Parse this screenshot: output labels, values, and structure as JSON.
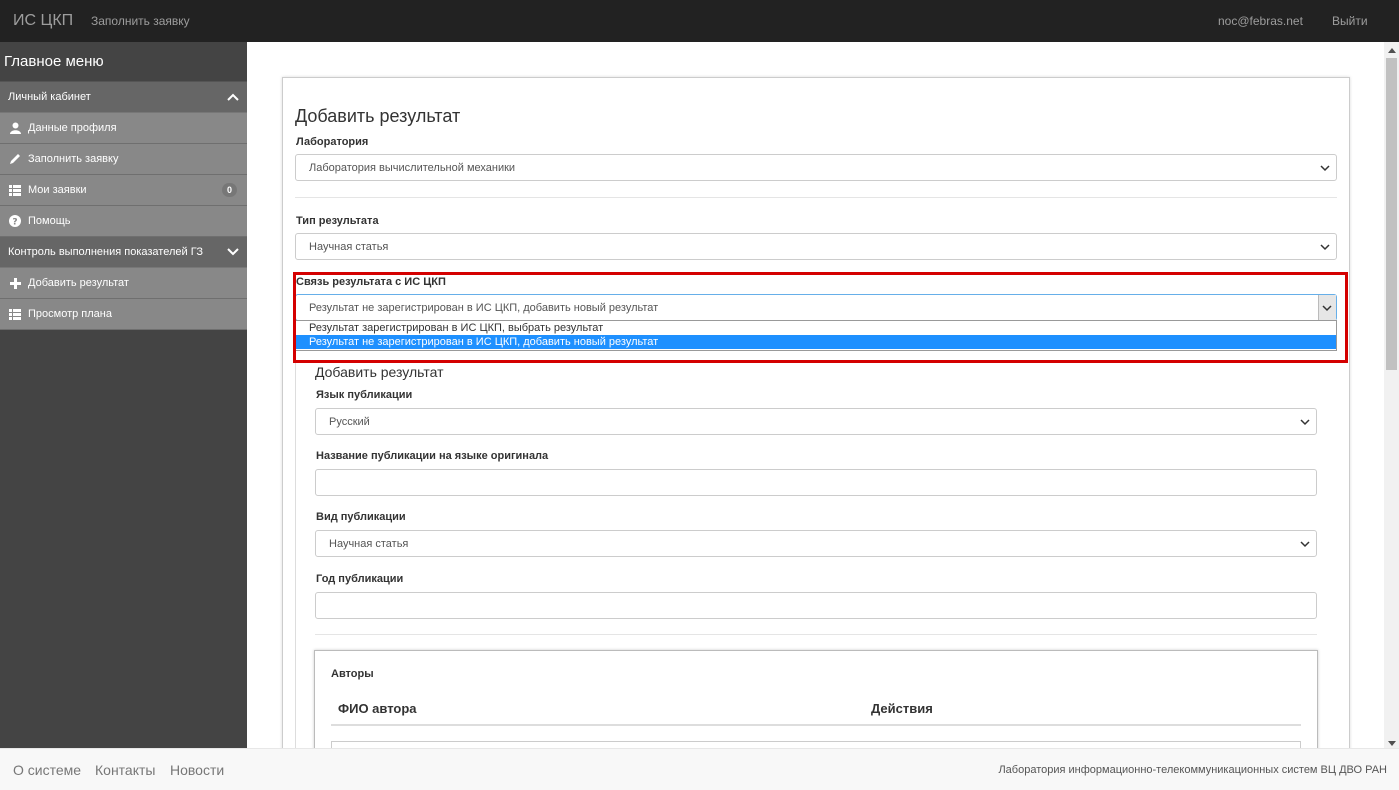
{
  "navbar": {
    "brand": "ИС ЦКП",
    "fill_request": "Заполнить заявку",
    "email": "noc@febras.net",
    "logout": "Выйти"
  },
  "sidebar": {
    "title": "Главное меню",
    "section_cabinet": "Личный кабинет",
    "item_profile": "Данные профиля",
    "item_fill": "Заполнить заявку",
    "item_my_requests": "Мои заявки",
    "my_requests_count": "0",
    "item_help": "Помощь",
    "section_control": "Контроль выполнения показателей ГЗ",
    "item_add_result": "Добавить результат",
    "item_view_plan": "Просмотр плана"
  },
  "form": {
    "title": "Добавить результат",
    "lab_label": "Лаборатория",
    "lab_value": "Лаборатория вычислительной механики",
    "type_label": "Тип результата",
    "type_value": "Научная статья",
    "link_label": "Связь результата с ИС ЦКП",
    "link_value": "Результат не зарегистрирован в ИС ЦКП, добавить новый результат",
    "link_options": [
      "Результат зарегистрирован в ИС ЦКП, выбрать результат",
      "Результат не зарегистрирован в ИС ЦКП, добавить новый результат"
    ],
    "sub_title": "Добавить результат",
    "lang_label": "Язык публикации",
    "lang_value": "Русский",
    "name_label": "Название публикации на языке оригинала",
    "name_value": "",
    "kind_label": "Вид публикации",
    "kind_value": "Научная статья",
    "year_label": "Год публикации",
    "year_value": "",
    "authors_title": "Авторы",
    "authors_col_name": "ФИО автора",
    "authors_col_actions": "Действия"
  },
  "footer": {
    "about": "О системе",
    "contacts": "Контакты",
    "news": "Новости",
    "org": "Лаборатория информационно-телекоммуникационных систем ВЦ ДВО РАН"
  }
}
